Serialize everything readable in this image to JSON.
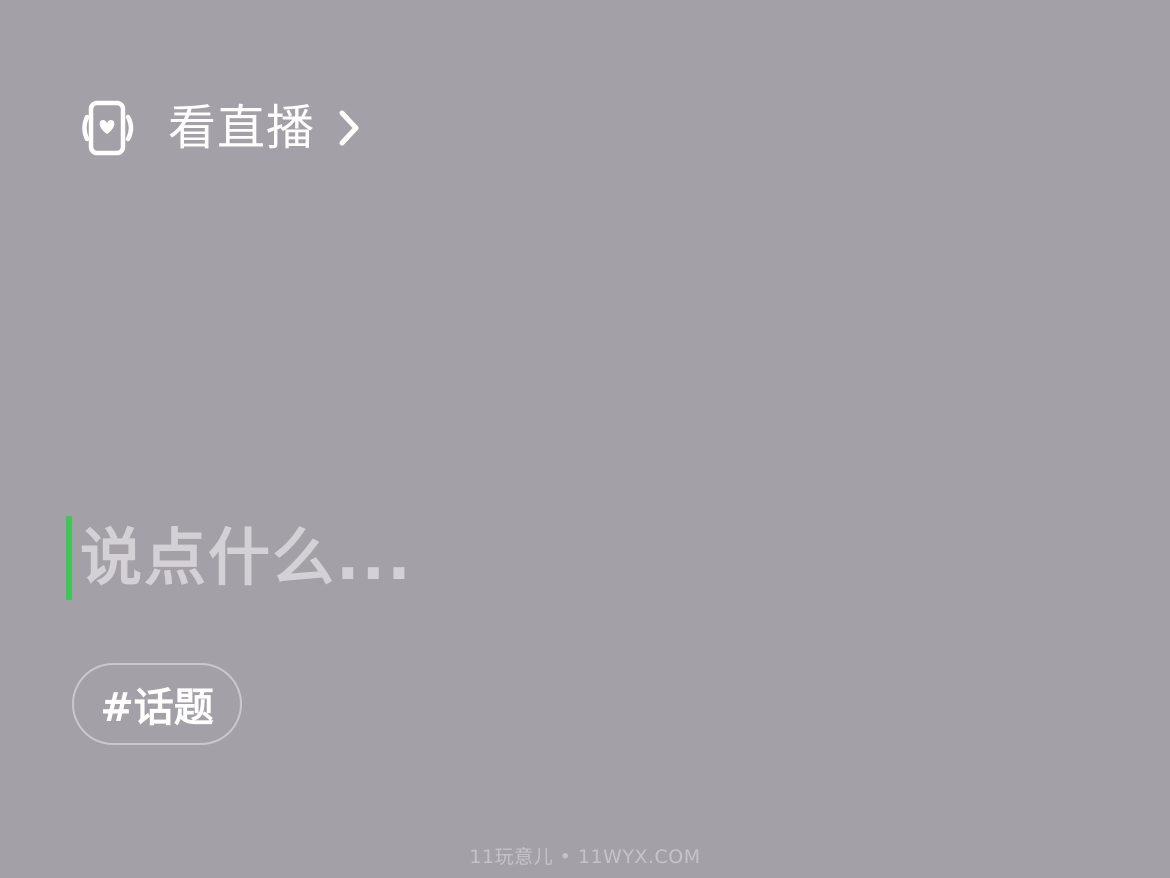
{
  "header": {
    "live_link": {
      "label": "看直播",
      "icon": "phone-heart-icon",
      "chevron": "chevron-right-icon"
    }
  },
  "compose": {
    "placeholder": "说点什么...",
    "caret_color": "#3fc657"
  },
  "topic_button": {
    "label": "#话题"
  },
  "watermark": {
    "text": "11玩意儿 • 11WYX.COM"
  },
  "colors": {
    "background": "#a4a0a7",
    "text_primary": "#ffffff",
    "placeholder": "#d3d0d6",
    "chip_border": "#cac7ce"
  }
}
